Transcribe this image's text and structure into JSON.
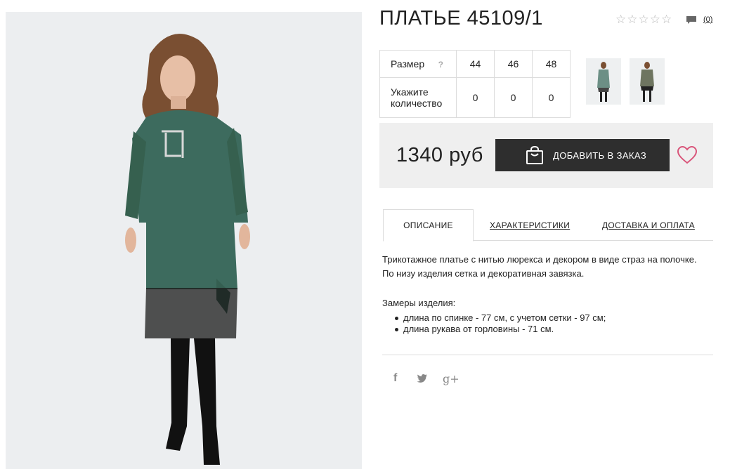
{
  "product": {
    "title": "ПЛАТЬЕ 45109/1",
    "rating_stars": 0,
    "review_count": "(0)"
  },
  "sizes": {
    "size_label": "Размер",
    "help_mark": "?",
    "values": [
      "44",
      "46",
      "48"
    ],
    "qty_label": "Укажите количество",
    "quantities": [
      "0",
      "0",
      "0"
    ]
  },
  "buy": {
    "price": "1340 руб",
    "add_label": "ДОБАВИТЬ В ЗАКАЗ"
  },
  "tabs": [
    {
      "label": "ОПИСАНИЕ",
      "active": true
    },
    {
      "label": "ХАРАКТЕРИСТИКИ",
      "active": false
    },
    {
      "label": "ДОСТАВКА И ОПЛАТА",
      "active": false
    }
  ],
  "description": {
    "line1": "Трикотажное платье с нитью люрекса и декором в виде страз на полочке.",
    "line2": "По низу изделия сетка и декоративная завязка.",
    "measurements_title": "Замеры изделия:",
    "measurements": [
      "длина по спинке - 77 см, с учетом сетки - 97 см;",
      "длина рукава от горловины - 71 см."
    ]
  },
  "social": {
    "facebook": "f",
    "twitter": "🐦",
    "google": "g+"
  },
  "colors": {
    "dress": "#3d6b5e",
    "button": "#2e2e2e",
    "heart": "#d9557a",
    "panel": "#efefef"
  }
}
